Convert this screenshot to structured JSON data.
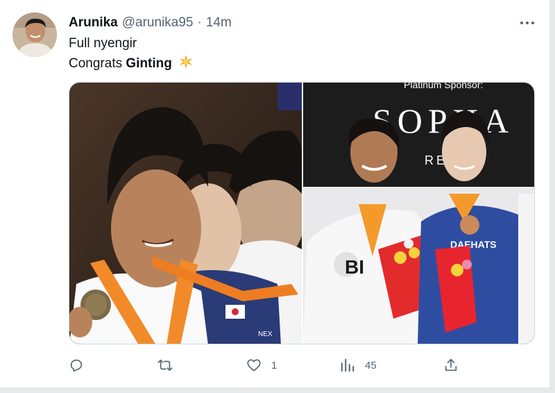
{
  "tweet": {
    "display_name": "Arunika",
    "handle": "@arunika95",
    "separator": "·",
    "time": "14m",
    "line1": "Full nyengir",
    "line2_prefix": "Congrats",
    "line2_bold": "Ginting",
    "emoji": "sparkle-star"
  },
  "media": {
    "left_photo": {
      "jersey_text": "NEX",
      "background_color": "#3a2b22"
    },
    "right_photo": {
      "banner_top": "Platinum Sponsor:",
      "banner_brand": "SOPHA",
      "banner_sub": "RE Y",
      "left_shirt_text": "BI",
      "right_shirt_text": "DAEHATS",
      "background_color": "#1a1a1a"
    }
  },
  "actions": {
    "reply_count": "",
    "retweet_count": "",
    "like_count": "1",
    "views_count": "45"
  },
  "colors": {
    "text": "#0f1419",
    "muted": "#536471",
    "border": "#cfd9de",
    "star": "#f4a31a"
  }
}
